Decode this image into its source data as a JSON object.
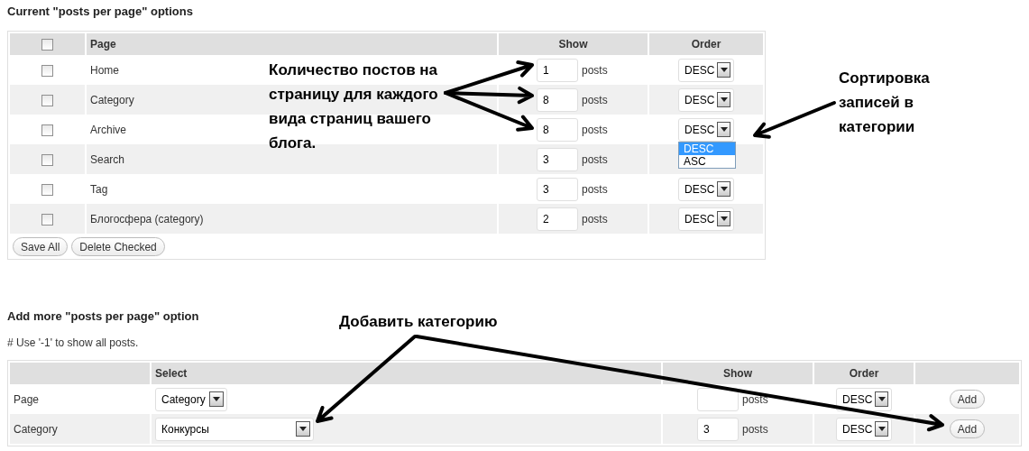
{
  "current_section": {
    "title": "Current \"posts per page\" options",
    "table": {
      "header_checkbox": {
        "checked": false
      },
      "columns": [
        "Page",
        "Show",
        "Order"
      ],
      "rows": [
        {
          "page": "Home",
          "checked": false,
          "show": "1",
          "unit": "posts",
          "order": "DESC"
        },
        {
          "page": "Category",
          "checked": false,
          "show": "8",
          "unit": "posts",
          "order": "DESC"
        },
        {
          "page": "Archive",
          "checked": false,
          "show": "8",
          "unit": "posts",
          "order": "DESC",
          "open_options": [
            {
              "label": "DESC",
              "selected": true
            },
            {
              "label": "ASC",
              "selected": false
            }
          ]
        },
        {
          "page": "Search",
          "checked": false,
          "show": "3",
          "unit": "posts"
        },
        {
          "page": "Tag",
          "checked": false,
          "show": "3",
          "unit": "posts",
          "order": "DESC"
        },
        {
          "page": "Блогосфера (category)",
          "checked": false,
          "show": "2",
          "unit": "posts",
          "order": "DESC"
        }
      ]
    },
    "buttons": [
      "Save All",
      "Delete Checked"
    ]
  },
  "add_section": {
    "title": "Add more \"posts per page\" option",
    "note": "# Use '-1' to show all posts.",
    "table": {
      "columns": [
        "Select",
        "Show",
        "Order"
      ],
      "rows": [
        {
          "label": "Page",
          "select": "Category",
          "unit": "posts",
          "order": "DESC",
          "button": "Add"
        },
        {
          "label": "Category",
          "select": "Конкурсы",
          "show": "3",
          "unit": "posts",
          "order": "DESC",
          "button": "Add"
        }
      ]
    }
  },
  "annotations": [
    {
      "text": "Количество постов на страницу для каждого вида страниц вашего блога."
    },
    {
      "text": "Сортировка записей в категории"
    },
    {
      "text": "Добавить категорию"
    }
  ]
}
